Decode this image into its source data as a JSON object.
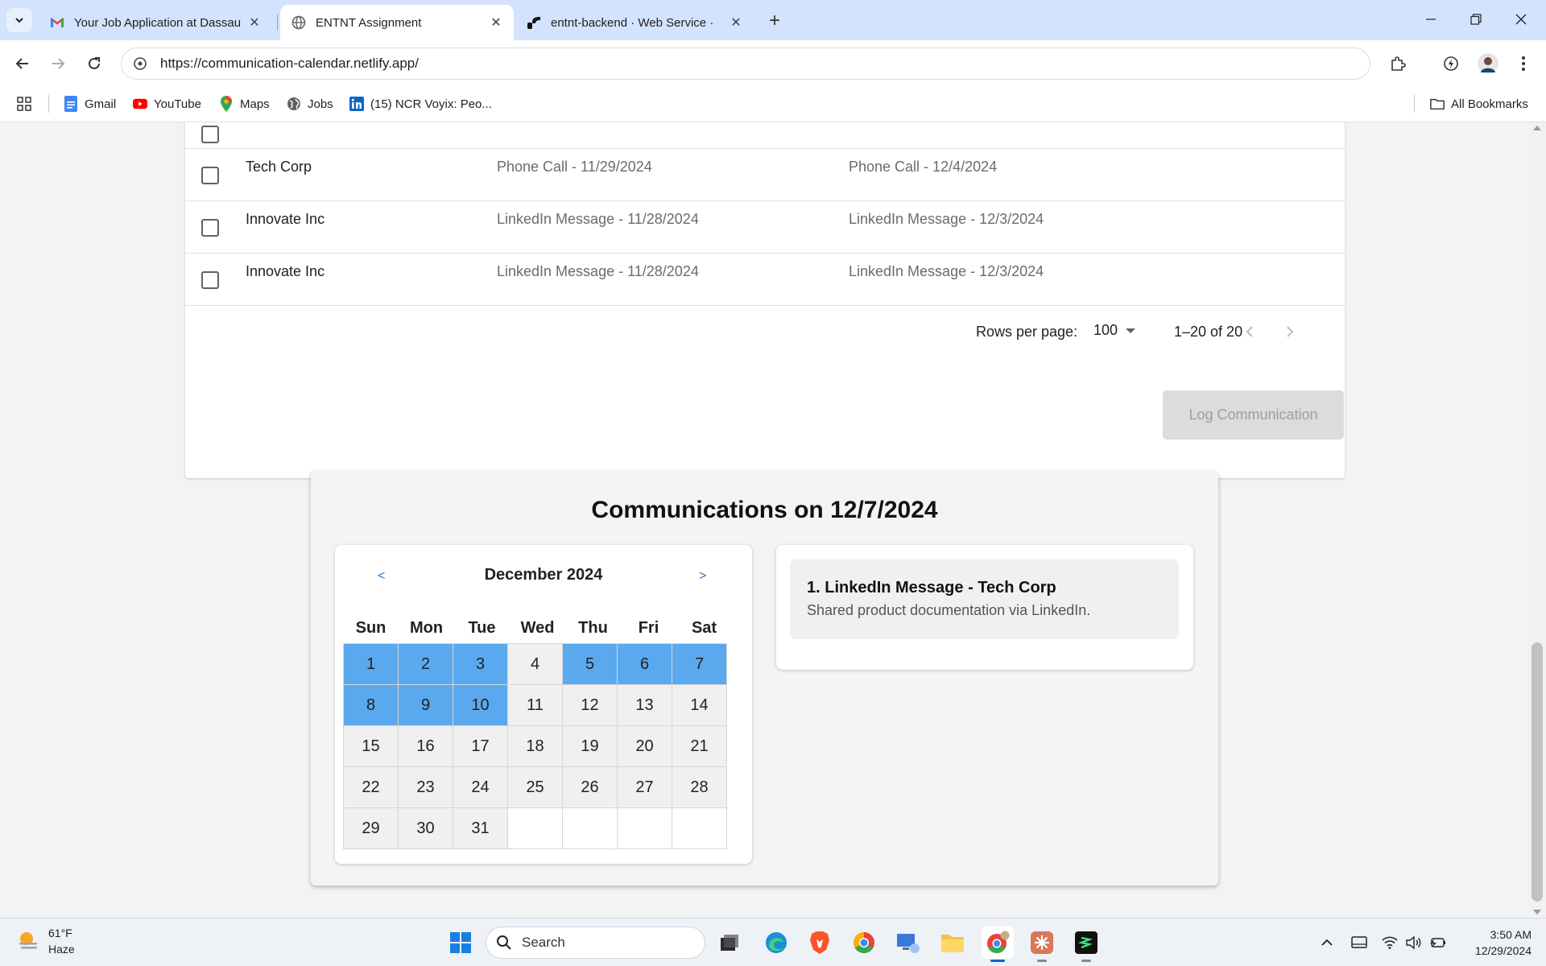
{
  "browser": {
    "tabs": [
      {
        "title": "Your Job Application at Dassault",
        "icon": "gmail-icon"
      },
      {
        "title": "ENTNT Assignment",
        "icon": "globe-icon"
      },
      {
        "title": "entnt-backend · Web Service ·",
        "icon": "render-icon"
      }
    ],
    "url": "https://communication-calendar.netlify.app/",
    "bookmarks": [
      {
        "label": "Gmail"
      },
      {
        "label": "YouTube"
      },
      {
        "label": "Maps"
      },
      {
        "label": "Jobs"
      },
      {
        "label": "(15) NCR Voyix: Peo..."
      }
    ],
    "all_bookmarks": "All Bookmarks"
  },
  "table": {
    "rows": [
      {
        "company": "Tech Corp",
        "last": "Phone Call - 11/29/2024",
        "next": "Phone Call - 12/4/2024"
      },
      {
        "company": "Innovate Inc",
        "last": "LinkedIn Message - 11/28/2024",
        "next": "LinkedIn Message - 12/3/2024"
      },
      {
        "company": "Innovate Inc",
        "last": "LinkedIn Message - 11/28/2024",
        "next": "LinkedIn Message - 12/3/2024"
      }
    ],
    "pagination": {
      "rows_per_page_label": "Rows per page:",
      "rows_per_page": "100",
      "range": "1–20 of 20"
    }
  },
  "log_button": "Log Communication",
  "communications": {
    "title": "Communications on 12/7/2024",
    "calendar": {
      "prev": "<",
      "next": ">",
      "month": "December 2024",
      "weekdays": [
        "Sun",
        "Mon",
        "Tue",
        "Wed",
        "Thu",
        "Fri",
        "Sat"
      ],
      "weeks": [
        [
          "1",
          "2",
          "3",
          "4",
          "5",
          "6",
          "7"
        ],
        [
          "8",
          "9",
          "10",
          "11",
          "12",
          "13",
          "14"
        ],
        [
          "15",
          "16",
          "17",
          "18",
          "19",
          "20",
          "21"
        ],
        [
          "22",
          "23",
          "24",
          "25",
          "26",
          "27",
          "28"
        ],
        [
          "29",
          "30",
          "31",
          "",
          "",
          "",
          ""
        ]
      ],
      "highlighted_days": [
        "1",
        "2",
        "3",
        "5",
        "6",
        "7",
        "8",
        "9",
        "10"
      ],
      "highlight_color": "#5aa9ee"
    },
    "events": [
      {
        "title": "1. LinkedIn Message - Tech Corp",
        "description": "Shared product documentation via LinkedIn."
      }
    ]
  },
  "taskbar": {
    "weather": {
      "temp": "61°F",
      "condition": "Haze"
    },
    "search_placeholder": "Search",
    "time": "3:50 AM",
    "date": "12/29/2024"
  }
}
